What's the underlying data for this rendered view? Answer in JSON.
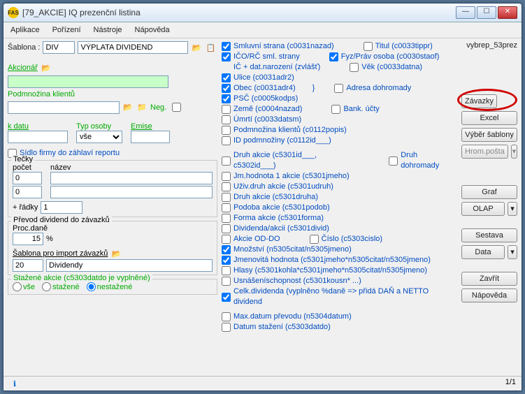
{
  "window": {
    "title": "[79_AKCIE] IQ prezenční listina",
    "icon_label": "FAS"
  },
  "menu": {
    "app": "Aplikace",
    "porizeni": "Pořízení",
    "nastroje": "Nástroje",
    "napoveda": "Nápověda"
  },
  "topbar": {
    "sablona_label": "Šablona :",
    "sablona1": "DIV",
    "sablona2": "VÝPLATA DIVIDEND"
  },
  "right_label": "vybrep_53prez",
  "left": {
    "akcionar": "Akcionář",
    "podmnozina": "Podmnožina klientů",
    "neg": "Neg.",
    "kdatu": "k datu",
    "typosoby": "Typ osoby",
    "emise": "Emise",
    "typosoby_val": "vše",
    "sidlo": "Sídlo firmy do záhlaví reportu",
    "tecky_title": "Tečky",
    "pocet": "počet",
    "nazev": "název",
    "pocet1": "0",
    "pocet2": "0",
    "radky_lbl": "+ řádky",
    "radky_val": "1",
    "prevod_title": "Převod dividend do závazků",
    "procdane": "Proc.daně",
    "procdane_val": "15",
    "procdane_unit": "%",
    "sablona_import": "Šablona pro import závazků",
    "sablona_import_code": "20",
    "sablona_import_name": "Dividendy",
    "stazene_title": "Stažené akcie (c5303datdo je vyplněné)",
    "radio_vse": "vše",
    "radio_stazene": "stažené",
    "radio_nestazene": "nestažené"
  },
  "checks": [
    {
      "c": true,
      "t": "Smluvní strana (c0031nazad)",
      "extra": {
        "c": false,
        "t": "Titul (c0033tippr)"
      }
    },
    {
      "c": true,
      "t": "IČO/RČ sml. strany",
      "extra": {
        "c": true,
        "t": "Fyz/Práv osoba (c0030staof)"
      }
    },
    {
      "c": null,
      "t": "IČ + dat.narození (zvlášť)",
      "extra": {
        "c": false,
        "t": "Věk (c0033datna)"
      }
    },
    {
      "c": true,
      "t": "Ulice (c0031adr2)"
    },
    {
      "c": true,
      "t": "Obec (c0031adr4)",
      "extra": {
        "c": false,
        "t": "Adresa dohromady"
      },
      "brace": true
    },
    {
      "c": true,
      "t": "PSČ (c0005kodps)"
    },
    {
      "c": false,
      "t": "Země (c0004nazad)",
      "extra": {
        "c": false,
        "t": "Bank. účty"
      }
    },
    {
      "c": false,
      "t": "Úmrtí (c0033datsm)"
    },
    {
      "c": false,
      "t": "Podmnožina klientů (c0112popis)"
    },
    {
      "c": false,
      "t": "ID podmnožiny (c0112id___)"
    },
    {
      "gap": true
    },
    {
      "c": false,
      "t": "Druh akcie (c5301id___, c5302id___)",
      "extra": {
        "c": false,
        "t": "Druh dohromady"
      }
    },
    {
      "c": false,
      "t": "Jm.hodnota 1 akcie (c5301jmeho)"
    },
    {
      "c": false,
      "t": "Uživ.druh akcie (c5301udruh)"
    },
    {
      "c": false,
      "t": "Druh akcie (c5301druha)"
    },
    {
      "c": false,
      "t": "Podoba akcie (c5301podob)"
    },
    {
      "c": false,
      "t": "Forma akcie (c5301forma)"
    },
    {
      "c": false,
      "t": "Dividenda/akcii (c5301divid)"
    },
    {
      "c": false,
      "t": "Akcie OD-DO",
      "extra": {
        "c": false,
        "t": "Číslo (c5303cislo)"
      }
    },
    {
      "c": true,
      "t": "Množství (n5305citat/n5305jmeno)"
    },
    {
      "c": true,
      "t": "Jmenovitá hodnota (c5301jmeho*n5305citat/n5305jmeno)"
    },
    {
      "c": false,
      "t": "Hlasy (c5301kohla*c5301jmeho*n5305citat/n5305jmeno)"
    },
    {
      "c": false,
      "t": "Usnášeníschopnost (c5301kousn* ...)"
    },
    {
      "c": true,
      "t": "Celk.dividenda (vyplněno %daně => přidá DAŇ a NETTO dividend"
    },
    {
      "gap": true
    },
    {
      "c": false,
      "t": "Max.datum převodu (n5304datum)"
    },
    {
      "c": false,
      "t": "Datum stažení (c5303datdo)"
    }
  ],
  "buttons": {
    "zavazky": "Závazky",
    "excel": "Excel",
    "vyber": "Výběr šablony",
    "hrom": "Hrom.pošta",
    "graf": "Graf",
    "olap": "OLAP",
    "sestava": "Sestava",
    "data": "Data",
    "zavrit": "Zavřít",
    "napoveda": "Nápověda"
  },
  "status": {
    "page": "1/1"
  }
}
